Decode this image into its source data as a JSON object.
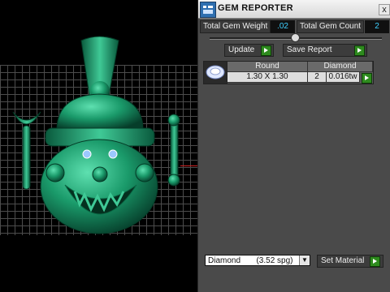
{
  "panel": {
    "title": "GEM REPORTER",
    "close_glyph": "x",
    "total_weight_label": "Total Gem Weight",
    "total_weight_value": ".02",
    "total_count_label": "Total Gem Count",
    "total_count_value": "2",
    "update_label": "Update",
    "save_report_label": "Save Report",
    "table": {
      "headers": [
        "Round",
        "Diamond"
      ],
      "rows": [
        {
          "size": "1.30 X 1.30",
          "count": "2",
          "weight": "0.016tw"
        }
      ]
    },
    "material_select_value": "Diamond       (3.52 spg)",
    "set_material_label": "Set Material"
  },
  "icons": {
    "app": "gem-reporter-app-icon",
    "close": "close-icon",
    "go": "green-arrow-icon",
    "gem_thumbnail": "round-gem-thumbnail-icon",
    "dropdown": "chevron-down-icon"
  },
  "colors": {
    "panel_bg": "#4a4a4a",
    "value_text": "#3fd0ff",
    "go_button": "#2e8b1e",
    "model": "#1e9a6a",
    "axis": "#d02020"
  }
}
